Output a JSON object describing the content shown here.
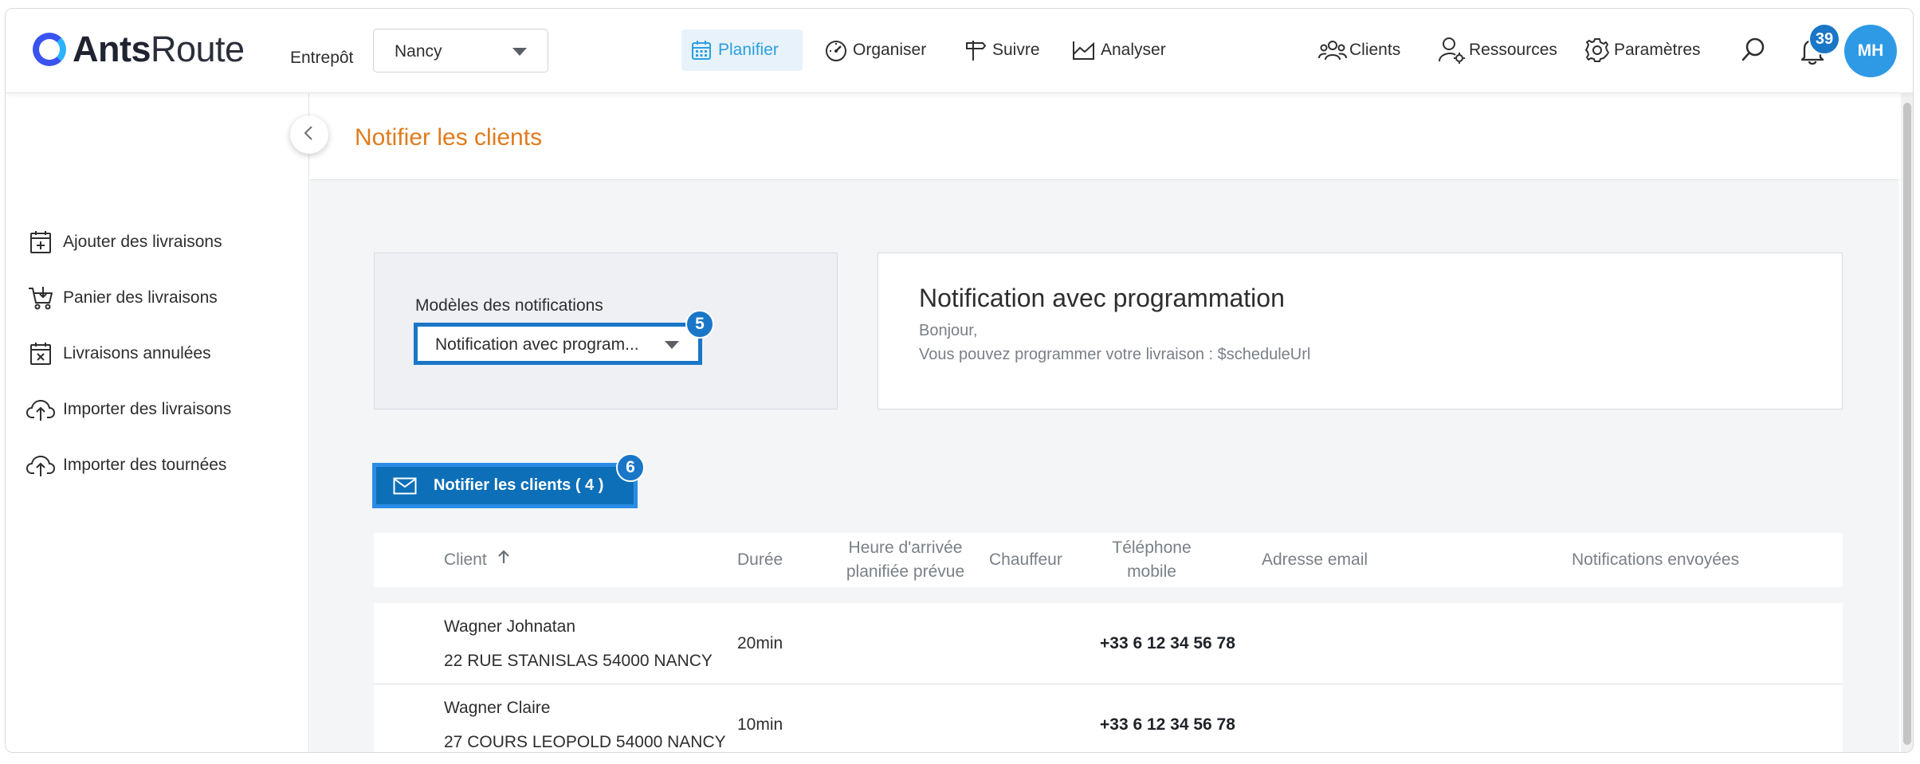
{
  "app": {
    "brand_bold": "Ants",
    "brand_light": "Route"
  },
  "header": {
    "entrepot_label": "Entrepôt",
    "entrepot_value": "Nancy",
    "nav": [
      {
        "label": "Planifier",
        "icon": "calendar-icon",
        "active": true
      },
      {
        "label": "Organiser",
        "icon": "gauge-icon"
      },
      {
        "label": "Suivre",
        "icon": "signpost-icon"
      },
      {
        "label": "Analyser",
        "icon": "chart-area-icon"
      }
    ],
    "right": [
      {
        "label": "Clients",
        "icon": "users-group-icon"
      },
      {
        "label": "Ressources",
        "icon": "user-gear-icon"
      },
      {
        "label": "Paramètres",
        "icon": "gear-icon"
      }
    ],
    "notifications_count": "39",
    "user_initials": "MH"
  },
  "sidebar": {
    "items": [
      {
        "label": "Ajouter des livraisons",
        "icon": "calendar-plus-icon"
      },
      {
        "label": "Panier des livraisons",
        "icon": "cart-icon"
      },
      {
        "label": "Livraisons annulées",
        "icon": "calendar-x-icon"
      },
      {
        "label": "Importer des livraisons",
        "icon": "cloud-upload-icon"
      },
      {
        "label": "Importer des tournées",
        "icon": "cloud-upload-icon"
      }
    ]
  },
  "main": {
    "page_title": "Notifier les clients",
    "templates": {
      "label": "Modèles des notifications",
      "selected": "Notification avec program...",
      "step": "5"
    },
    "preview": {
      "title": "Notification avec programmation",
      "line1": "Bonjour,",
      "line2": "Vous pouvez programmer votre livraison : $scheduleUrl"
    },
    "notify_button": {
      "label": "Notifier les clients ( 4 )",
      "step": "6"
    },
    "table": {
      "headers": {
        "client": "Client",
        "duree": "Durée",
        "arrivee_1": "Heure d'arrivée",
        "arrivee_2": "planifiée prévue",
        "chauffeur": "Chauffeur",
        "telephone_1": "Téléphone",
        "telephone_2": "mobile",
        "email": "Adresse email",
        "notifications": "Notifications envoyées"
      },
      "rows": [
        {
          "name": "Wagner Johnatan",
          "address": "22 RUE STANISLAS 54000 NANCY",
          "duree": "20min",
          "telephone": "+33 6 12 34 56 78"
        },
        {
          "name": "Wagner Claire",
          "address": "27 COURS LEOPOLD 54000 NANCY",
          "duree": "10min",
          "telephone": "+33 6 12 34 56 78"
        }
      ]
    }
  },
  "colors": {
    "accent_blue": "#1a76c7",
    "active_nav": "#2aa0e0",
    "title_orange": "#e07b1e",
    "avatar_blue": "#2e9ae6"
  }
}
